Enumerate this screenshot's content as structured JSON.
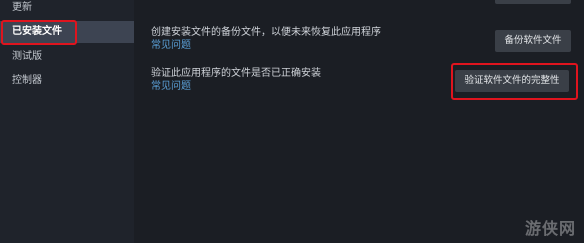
{
  "sidebar": {
    "items": [
      {
        "label": "更新"
      },
      {
        "label": "已安装文件"
      },
      {
        "label": "测试版"
      },
      {
        "label": "控制器"
      }
    ]
  },
  "sections": [
    {
      "description": "创建安装文件的备份文件，以便未来恢复此应用程序",
      "link": "常见问题",
      "button": "备份软件文件"
    },
    {
      "description": "验证此应用程序的文件是否已正确安装",
      "link": "常见问题",
      "button": "验证软件文件的完整性"
    }
  ],
  "watermark": "游侠网",
  "colors": {
    "background": "#1b1e24",
    "sidebar": "#1f232b",
    "active_item": "#3d4452",
    "highlight": "#e0141e",
    "link": "#5a9fd6",
    "button": "#3a3f47"
  }
}
